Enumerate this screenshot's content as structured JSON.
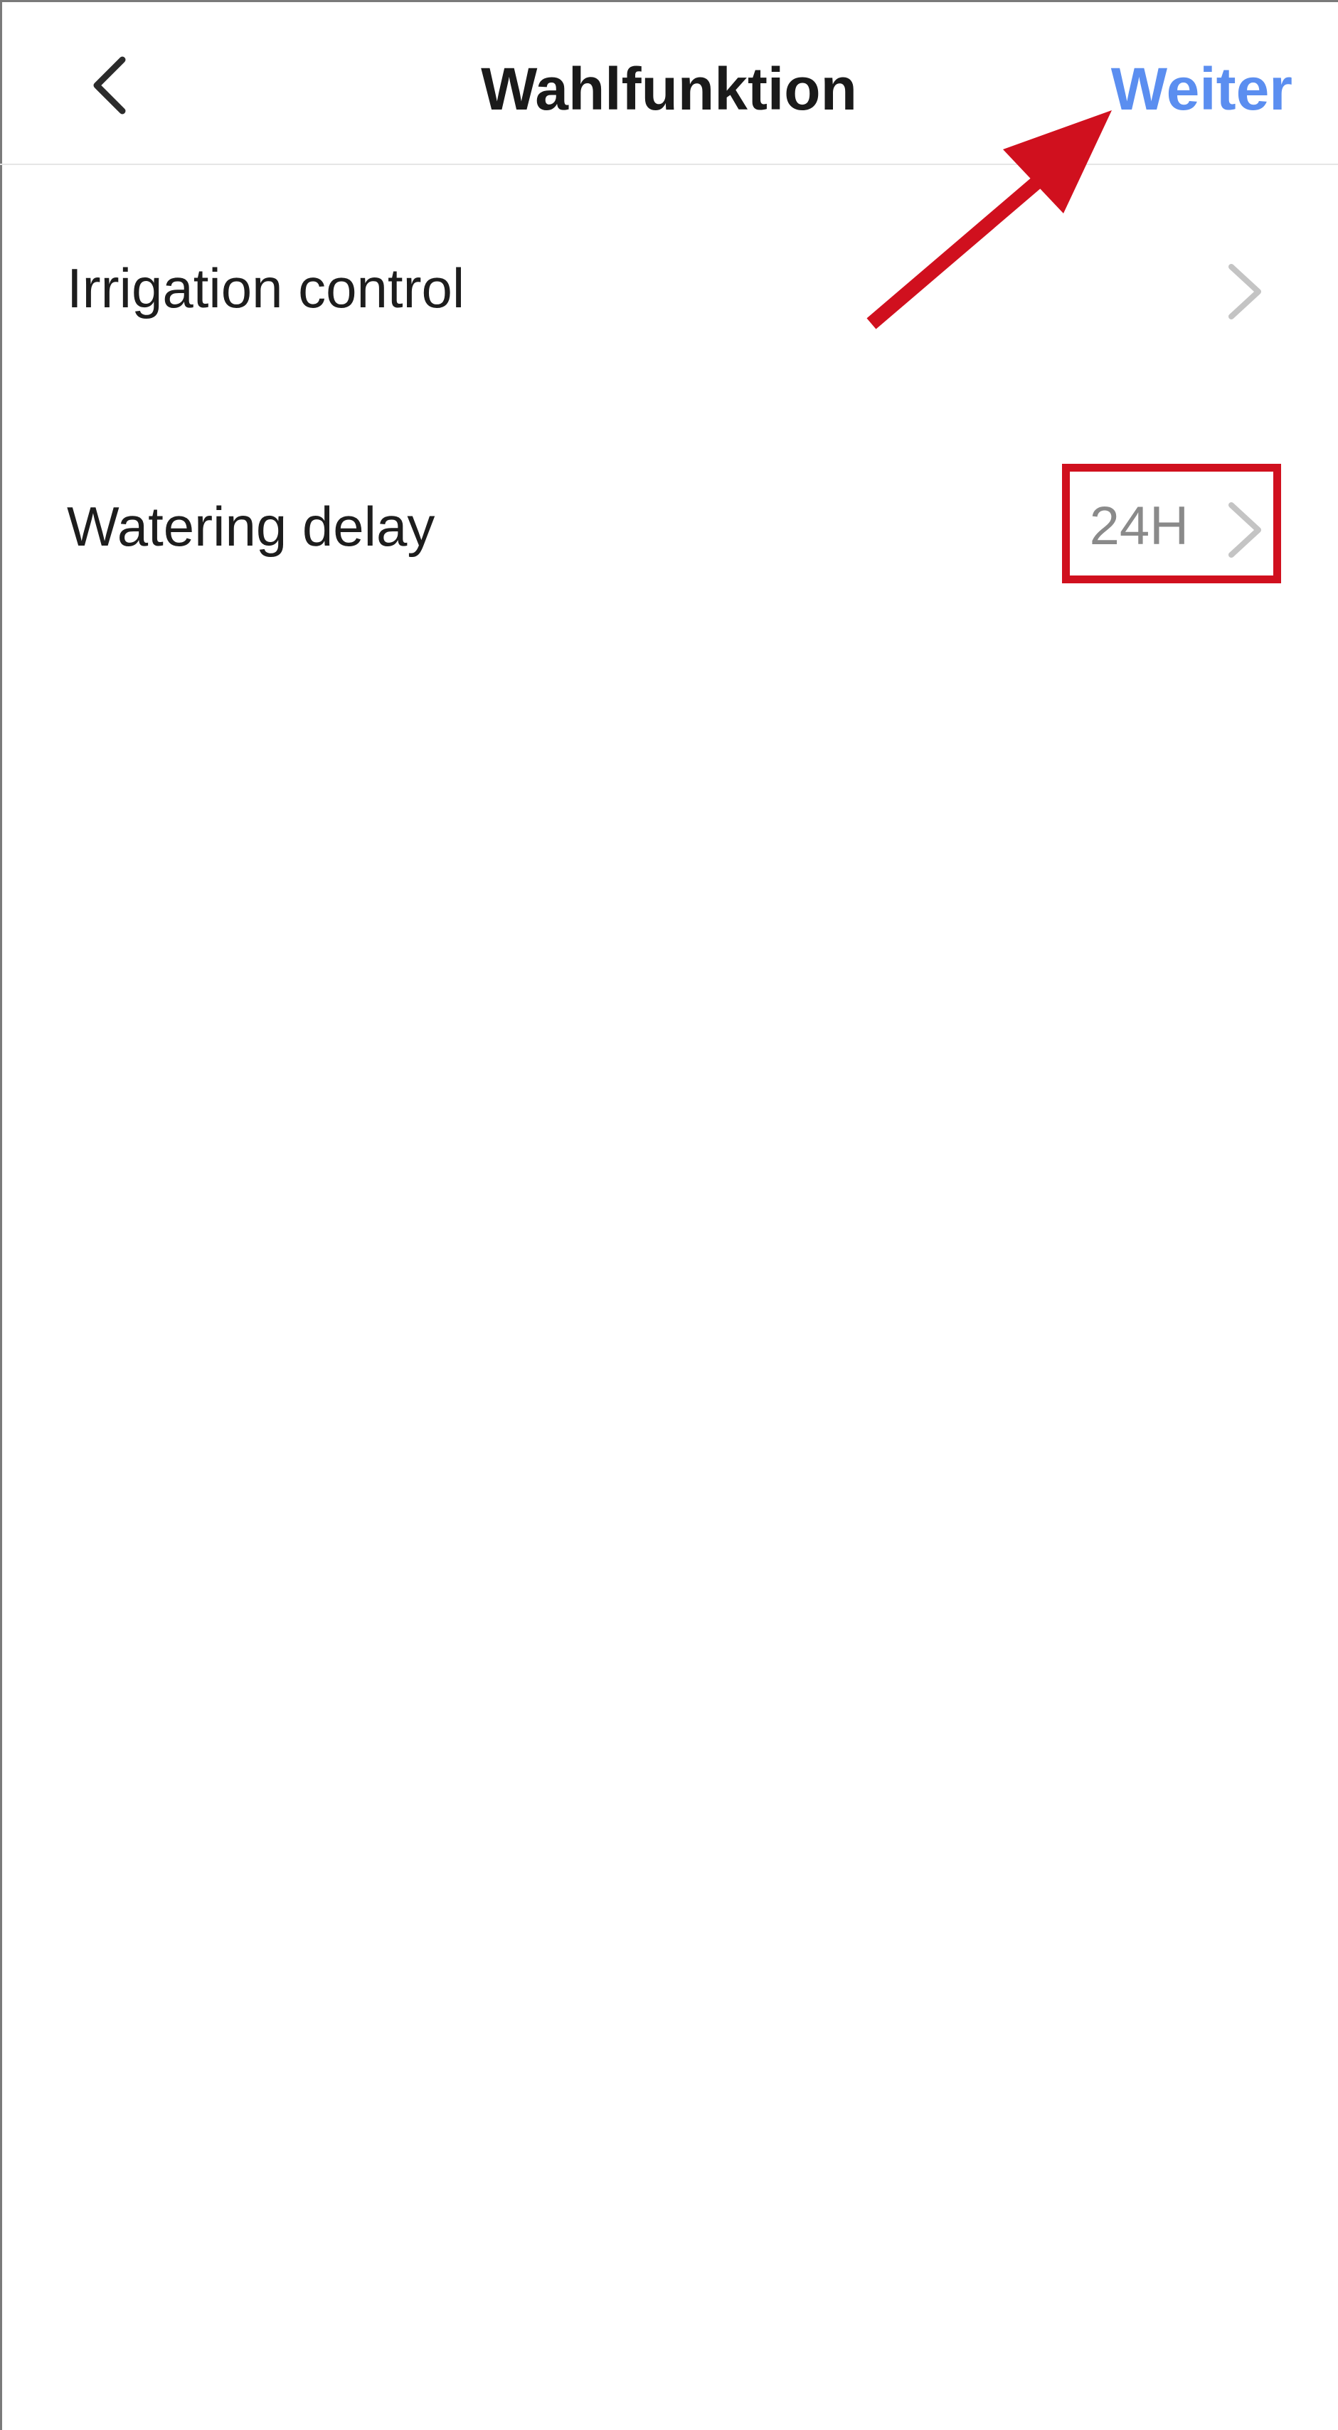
{
  "header": {
    "back_icon": "chevron-left-icon",
    "title": "Wahlfunktion",
    "next_label": "Weiter",
    "next_color": "#5b8ef0"
  },
  "list": {
    "items": [
      {
        "label": "Irrigation control",
        "value": "",
        "icon": "chevron-right-icon"
      },
      {
        "label": "Watering delay",
        "value": "24H",
        "icon": "chevron-right-icon"
      }
    ]
  },
  "annotations": {
    "highlight_color": "#d0101e",
    "arrow_color": "#d0101e"
  }
}
